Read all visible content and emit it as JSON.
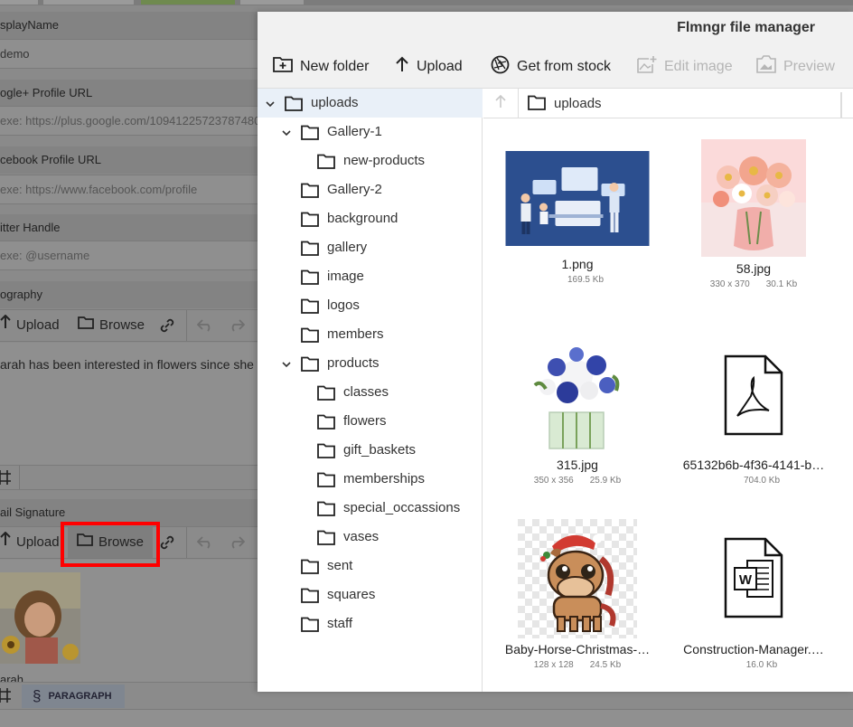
{
  "background_form": {
    "fields": [
      {
        "label": "splayName",
        "value": "demo",
        "is_placeholder": false
      },
      {
        "label": "ogle+ Profile URL",
        "value": "exe: https://plus.google.com/10941225723787480",
        "is_placeholder": true
      },
      {
        "label": "cebook Profile URL",
        "value": "exe: https://www.facebook.com/profile",
        "is_placeholder": true
      },
      {
        "label": "itter Handle",
        "value": "exe: @username",
        "is_placeholder": true
      }
    ],
    "biography": {
      "label": "ography",
      "upload_label": "Upload",
      "browse_label": "Browse",
      "text": "arah has been interested in flowers since she w"
    },
    "signature": {
      "label": "ail Signature",
      "upload_label": "Upload",
      "browse_label": "Browse",
      "name_text": "arah"
    },
    "paragraph_label": "PARAGRAPH"
  },
  "file_manager": {
    "title": "Flmngr file manager",
    "toolbar": {
      "new_folder": "New folder",
      "upload": "Upload",
      "get_from_stock": "Get from stock",
      "edit_image": "Edit image",
      "preview": "Preview"
    },
    "tree": [
      {
        "label": "uploads",
        "level": 0,
        "expanded": true,
        "selected": true
      },
      {
        "label": "Gallery-1",
        "level": 1,
        "expanded": true
      },
      {
        "label": "new-products",
        "level": 2
      },
      {
        "label": "Gallery-2",
        "level": 1
      },
      {
        "label": "background",
        "level": 1
      },
      {
        "label": "gallery",
        "level": 1
      },
      {
        "label": "image",
        "level": 1
      },
      {
        "label": "logos",
        "level": 1
      },
      {
        "label": "members",
        "level": 1
      },
      {
        "label": "products",
        "level": 1,
        "expanded": true
      },
      {
        "label": "classes",
        "level": 2
      },
      {
        "label": "flowers",
        "level": 2
      },
      {
        "label": "gift_baskets",
        "level": 2
      },
      {
        "label": "memberships",
        "level": 2
      },
      {
        "label": "special_occassions",
        "level": 2
      },
      {
        "label": "vases",
        "level": 2
      },
      {
        "label": "sent",
        "level": 1
      },
      {
        "label": "squares",
        "level": 1
      },
      {
        "label": "staff",
        "level": 1
      }
    ],
    "path": "uploads",
    "files": [
      {
        "name": "1.png",
        "dims": "",
        "size": "169.5 Kb",
        "kind": "illustration"
      },
      {
        "name": "58.jpg",
        "dims": "330 x 370",
        "size": "30.1 Kb",
        "kind": "flowers-pink"
      },
      {
        "name": "315.jpg",
        "dims": "350 x 356",
        "size": "25.9 Kb",
        "kind": "flowers-blue"
      },
      {
        "name": "65132b6b-4f36-4141-b…",
        "dims": "",
        "size": "704.0 Kb",
        "kind": "pdf"
      },
      {
        "name": "Baby-Horse-Christmas-…",
        "dims": "128 x 128",
        "size": "24.5 Kb",
        "kind": "horse"
      },
      {
        "name": "Construction-Manager.…",
        "dims": "",
        "size": "16.0 Kb",
        "kind": "word"
      }
    ],
    "colors": {
      "selected_row": "#e9f0f8",
      "disabled_tool": "#b5b5b5",
      "highlight_box": "#ff0000"
    }
  }
}
